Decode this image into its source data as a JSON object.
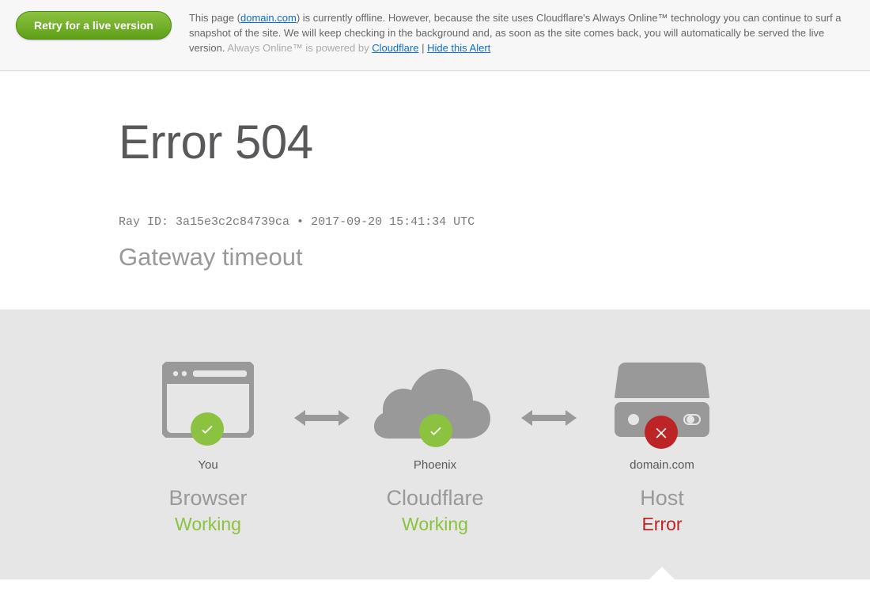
{
  "alert": {
    "retry_label": "Retry for a live version",
    "text_prefix": "This page (",
    "domain_link": "domain.com",
    "text_mid": ") is currently offline. However, because the site uses Cloudflare's Always Online™ technology you can continue to surf a snapshot of the site. We will keep checking in the background and, as soon as the site comes back, you will automatically be served the live version. ",
    "powered_text": "Always Online™ is powered by ",
    "cloudflare_link": "Cloudflare",
    "separator": " | ",
    "hide_link": "Hide this Alert"
  },
  "error": {
    "title": "Error 504",
    "ray_label": "Ray ID: ",
    "ray_id": "3a15e3c2c84739ca",
    "ray_sep": " • ",
    "timestamp": "2017-09-20 15:41:34 UTC",
    "subtitle": "Gateway timeout"
  },
  "diag": {
    "you": {
      "label": "You",
      "component": "Browser",
      "status": "Working"
    },
    "cf": {
      "label": "Phoenix",
      "component": "Cloudflare",
      "status": "Working"
    },
    "host": {
      "label": "domain.com",
      "component": "Host",
      "status": "Error"
    }
  }
}
